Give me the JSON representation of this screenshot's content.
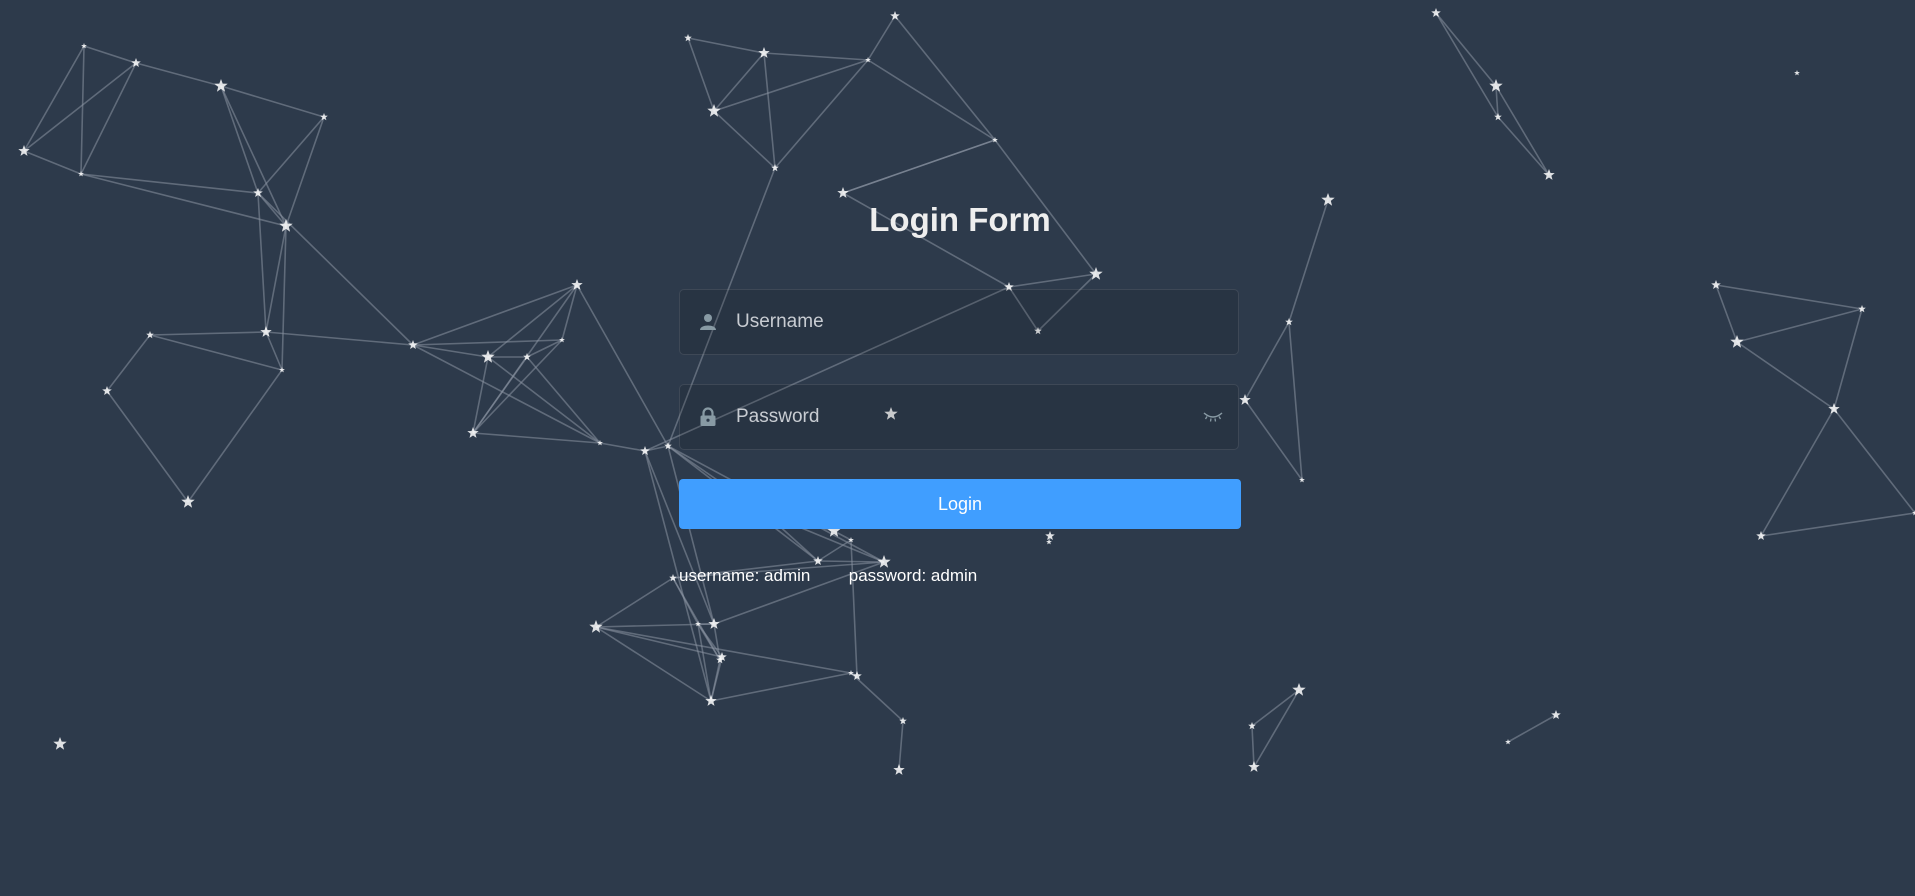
{
  "form": {
    "title": "Login Form",
    "username": {
      "placeholder": "Username",
      "value": "",
      "icon": "user-icon"
    },
    "password": {
      "placeholder": "Password",
      "value": "",
      "icon": "lock-icon",
      "toggle_icon": "eye-closed-icon"
    },
    "login_label": "Login",
    "tips": {
      "username": "username: admin",
      "password": "password: admin"
    }
  },
  "colors": {
    "background": "#2d3a4b",
    "accent": "#409eff",
    "title": "#eeeeee",
    "star": "#ffffff",
    "line": "#8a94a3"
  },
  "background_decoration": "constellation"
}
